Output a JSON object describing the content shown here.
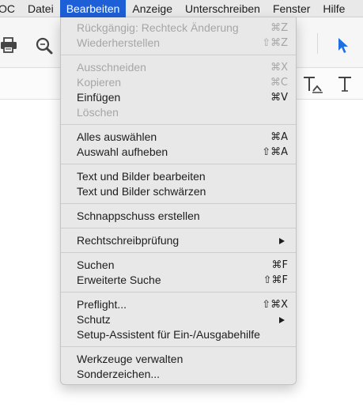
{
  "menubar": {
    "items": [
      "OC",
      "Datei",
      "Bearbeiten",
      "Anzeige",
      "Unterschreiben",
      "Fenster",
      "Hilfe"
    ]
  },
  "toolbar": {
    "icons": [
      "print-icon",
      "zoom-icon",
      "pointer-icon",
      "text-edit-icon",
      "text-icon"
    ]
  },
  "edit_menu": {
    "items": [
      {
        "label": "Rückgängig: Rechteck Änderung",
        "shortcut": "⌘Z",
        "enabled": false
      },
      {
        "label": "Wiederherstellen",
        "shortcut": "⇧⌘Z",
        "enabled": false
      },
      {
        "label": "Ausschneiden",
        "shortcut": "⌘X",
        "enabled": false
      },
      {
        "label": "Kopieren",
        "shortcut": "⌘C",
        "enabled": false
      },
      {
        "label": "Einfügen",
        "shortcut": "⌘V",
        "enabled": true
      },
      {
        "label": "Löschen",
        "shortcut": "",
        "enabled": false
      },
      {
        "label": "Alles auswählen",
        "shortcut": "⌘A",
        "enabled": true
      },
      {
        "label": "Auswahl aufheben",
        "shortcut": "⇧⌘A",
        "enabled": true
      },
      {
        "label": "Text und Bilder bearbeiten",
        "shortcut": "",
        "enabled": true
      },
      {
        "label": "Text und Bilder schwärzen",
        "shortcut": "",
        "enabled": true
      },
      {
        "label": "Schnappschuss erstellen",
        "shortcut": "",
        "enabled": true
      },
      {
        "label": "Rechtschreibprüfung",
        "shortcut": "",
        "enabled": true,
        "submenu": true
      },
      {
        "label": "Suchen",
        "shortcut": "⌘F",
        "enabled": true
      },
      {
        "label": "Erweiterte Suche",
        "shortcut": "⇧⌘F",
        "enabled": true
      },
      {
        "label": "Preflight...",
        "shortcut": "⇧⌘X",
        "enabled": true
      },
      {
        "label": "Schutz",
        "shortcut": "",
        "enabled": true,
        "submenu": true
      },
      {
        "label": "Setup-Assistent für Ein-/Ausgabehilfe",
        "shortcut": "",
        "enabled": true
      },
      {
        "label": "Werkzeuge verwalten",
        "shortcut": "",
        "enabled": true
      },
      {
        "label": "Sonderzeichen...",
        "shortcut": "",
        "enabled": true
      }
    ]
  },
  "colors": {
    "menu_highlight": "#1c5fd6",
    "menu_background": "#e8e8e8",
    "disabled_text": "#a6a6a6",
    "pointer_accent": "#1f6fe0"
  }
}
